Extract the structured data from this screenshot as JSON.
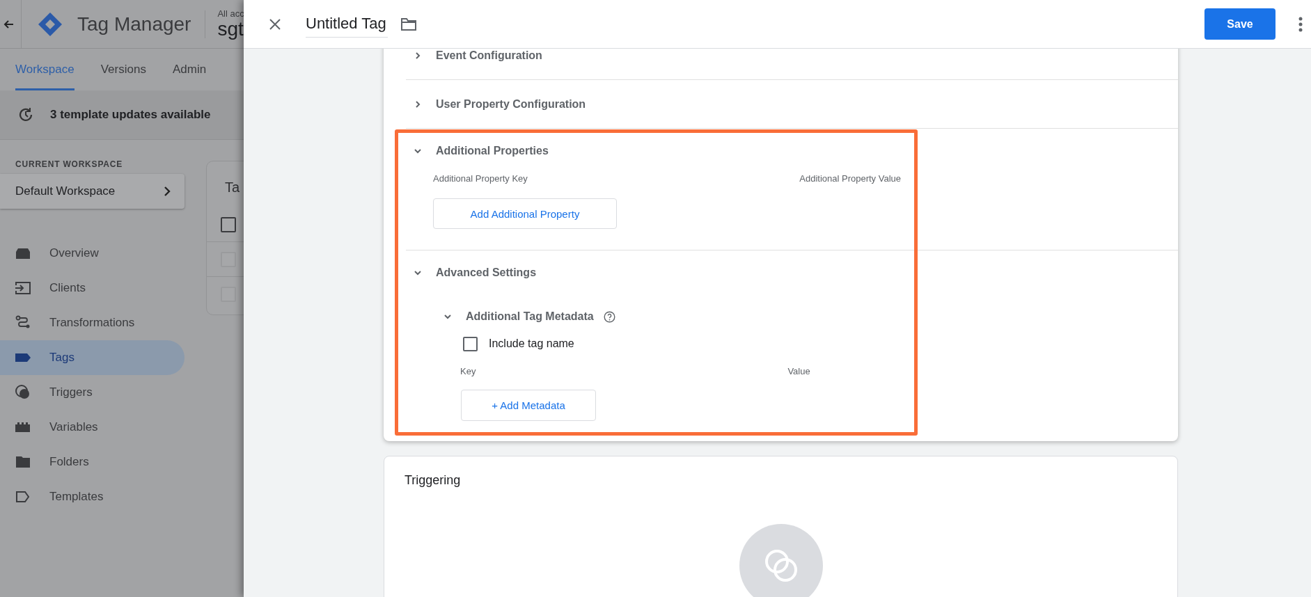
{
  "background_app": {
    "product": "Tag Manager",
    "account_label": "All acc",
    "container_name": "sgt",
    "tabs": [
      {
        "label": "Workspace",
        "selected": true
      },
      {
        "label": "Versions",
        "selected": false
      },
      {
        "label": "Admin",
        "selected": false
      }
    ],
    "notice": "3 template updates available",
    "workspace_label": "CURRENT WORKSPACE",
    "workspace": "Default Workspace",
    "nav": [
      {
        "label": "Overview",
        "selected": false
      },
      {
        "label": "Clients",
        "selected": false
      },
      {
        "label": "Transformations",
        "selected": false
      },
      {
        "label": "Tags",
        "selected": true
      },
      {
        "label": "Triggers",
        "selected": false
      },
      {
        "label": "Variables",
        "selected": false
      },
      {
        "label": "Folders",
        "selected": false
      },
      {
        "label": "Templates",
        "selected": false
      }
    ],
    "list_card": {
      "title": "Ta",
      "rows": [
        {
          "checked": false
        },
        {
          "checked": false
        },
        {
          "checked": false
        }
      ]
    }
  },
  "editor": {
    "title": "Untitled Tag",
    "save": "Save",
    "sections": [
      {
        "title": "Event Configuration",
        "expanded": false,
        "highlighted": false
      },
      {
        "title": "User Property Configuration",
        "expanded": false,
        "highlighted": false
      },
      {
        "title": "Additional Properties",
        "expanded": true,
        "highlighted": true,
        "kind": "properties",
        "key_label": "Additional Property Key",
        "value_label": "Additional Property Value",
        "button": "Add Additional Property"
      },
      {
        "title": "Advanced Settings",
        "expanded": true,
        "highlighted": true,
        "kind": "advanced",
        "subsection": {
          "title": "Additional Tag Metadata",
          "expanded": true,
          "checkbox": {
            "label": "Include tag name",
            "checked": false
          },
          "key_label": "Key",
          "value_label": "Value",
          "button": "+ Add Metadata"
        }
      }
    ],
    "triggering": {
      "title": "Triggering"
    }
  }
}
